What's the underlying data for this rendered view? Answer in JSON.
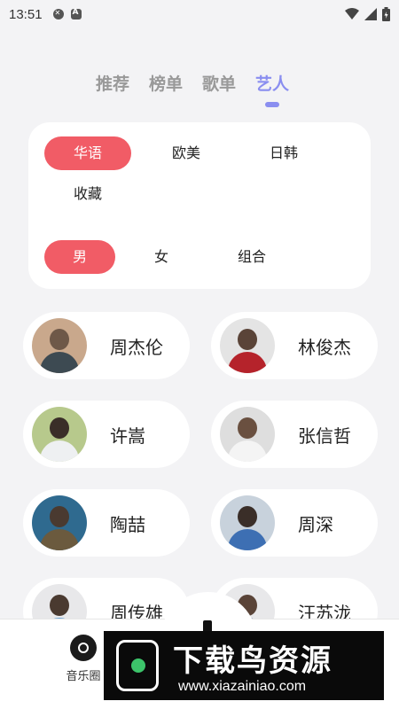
{
  "status_bar": {
    "time": "13:51",
    "icons_left": [
      "close-circle-icon",
      "a-icon"
    ],
    "icons_right": [
      "wifi-icon",
      "signal-icon",
      "battery-icon"
    ]
  },
  "tabs": [
    {
      "label": "推荐",
      "active": false
    },
    {
      "label": "榜单",
      "active": false
    },
    {
      "label": "歌单",
      "active": false
    },
    {
      "label": "艺人",
      "active": true
    }
  ],
  "filters": {
    "regions": [
      {
        "label": "华语",
        "active": true
      },
      {
        "label": "欧美",
        "active": false
      },
      {
        "label": "日韩",
        "active": false
      },
      {
        "label": "收藏",
        "active": false
      }
    ],
    "genders": [
      {
        "label": "男",
        "active": true
      },
      {
        "label": "女",
        "active": false
      },
      {
        "label": "组合",
        "active": false
      }
    ]
  },
  "artists": [
    {
      "name": "周杰伦"
    },
    {
      "name": "林俊杰"
    },
    {
      "name": "许嵩"
    },
    {
      "name": "张信哲"
    },
    {
      "name": "陶喆"
    },
    {
      "name": "周深"
    },
    {
      "name": "周传雄"
    },
    {
      "name": "汪苏泷"
    }
  ],
  "bottom_nav": {
    "left_label": "音乐圈"
  },
  "watermark": {
    "title": "下载鸟资源",
    "url": "www.xiazainiao.com"
  },
  "colors": {
    "accent": "#8a8ef0",
    "chip_active": "#f15c66",
    "background": "#f3f3f5"
  }
}
